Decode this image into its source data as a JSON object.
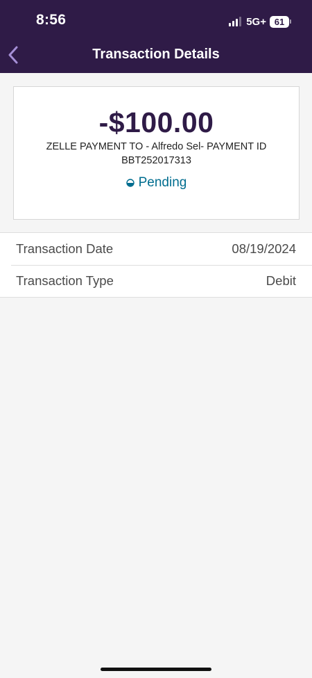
{
  "status_bar": {
    "time": "8:56",
    "network": "5G+",
    "battery": "61"
  },
  "header": {
    "title": "Transaction Details",
    "back_icon": "chevron-left-icon"
  },
  "transaction": {
    "amount": "-$100.00",
    "description_line1": "ZELLE PAYMENT TO - Alfredo Sel- PAYMENT ID",
    "description_line2": "BBT252017313",
    "status": "Pending",
    "status_icon": "half-circle-pending-icon"
  },
  "details": [
    {
      "label": "Transaction Date",
      "value": "08/19/2024"
    },
    {
      "label": "Transaction Type",
      "value": "Debit"
    }
  ],
  "colors": {
    "header_bg": "#2f1b47",
    "amount_text": "#2f1b47",
    "status_text": "#006d8f",
    "page_bg": "#f5f5f5",
    "back_icon": "#a58fd6"
  }
}
